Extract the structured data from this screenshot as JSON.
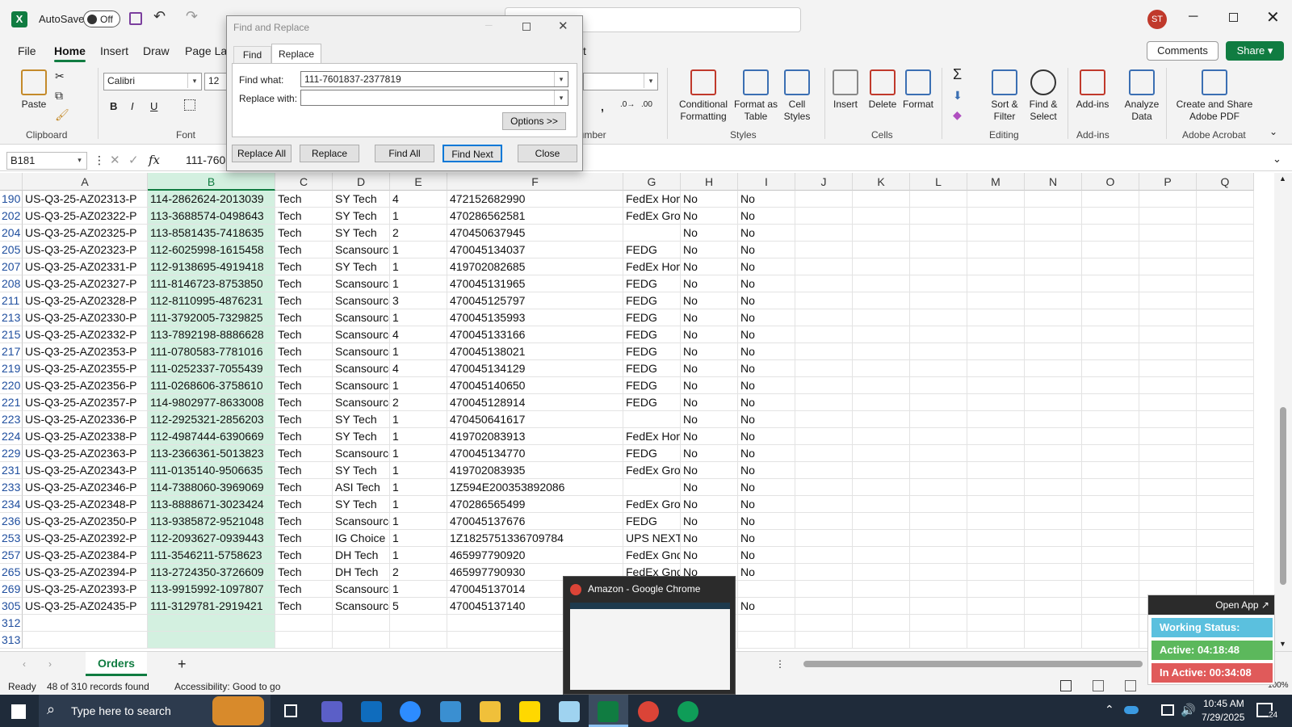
{
  "titlebar": {
    "autosave_label": "AutoSave",
    "autosave_state": "Off",
    "avatar_initials": "ST"
  },
  "menu": {
    "items": [
      "File",
      "Home",
      "Insert",
      "Draw",
      "Page Layout",
      "t"
    ],
    "comments": "Comments",
    "share": "Share"
  },
  "ribbon": {
    "paste": "Paste",
    "clipboard": "Clipboard",
    "font_name": "Calibri",
    "font_size": "12",
    "font_group": "Font",
    "number_group": "Number",
    "conditional": "Conditional Formatting",
    "format_table": "Format as Table",
    "cell_styles": "Cell Styles",
    "styles_group": "Styles",
    "insert": "Insert",
    "delete": "Delete",
    "format": "Format",
    "cells_group": "Cells",
    "sort_filter": "Sort & Filter",
    "find_select": "Find & Select",
    "editing_group": "Editing",
    "addins": "Add-ins",
    "addins_group": "Add-ins",
    "analyze": "Analyze Data",
    "create_pdf": "Create and Share Adobe PDF",
    "acrobat_group": "Adobe Acrobat"
  },
  "formula_bar": {
    "name_box": "B181",
    "fx": "fx",
    "content": "111-7601837-2377819"
  },
  "dialog": {
    "title": "Find and Replace",
    "tab_find": "Find",
    "tab_replace": "Replace",
    "find_label": "Find what:",
    "find_value": "111-7601837-2377819",
    "replace_label": "Replace with:",
    "replace_value": "",
    "options": "Options >>",
    "replace_all": "Replace All",
    "replace": "Replace",
    "find_all": "Find All",
    "find_next": "Find Next",
    "close": "Close"
  },
  "columns": [
    "A",
    "B",
    "C",
    "D",
    "E",
    "F",
    "G",
    "H",
    "I",
    "J",
    "K",
    "L",
    "M",
    "N",
    "O",
    "P",
    "Q"
  ],
  "rows": [
    [
      "190",
      "US-Q3-25-AZ02313-P",
      "114-2862624-2013039",
      "Tech",
      "SY Tech",
      "4",
      "472152682990",
      "FedEx Hom",
      "No",
      "No"
    ],
    [
      "202",
      "US-Q3-25-AZ02322-P",
      "113-3688574-0498643",
      "Tech",
      "SY Tech",
      "1",
      "470286562581",
      "FedEx Grou",
      "No",
      "No"
    ],
    [
      "204",
      "US-Q3-25-AZ02325-P",
      "113-8581435-7418635",
      "Tech",
      "SY Tech",
      "2",
      "470450637945",
      "",
      "No",
      "No"
    ],
    [
      "205",
      "US-Q3-25-AZ02323-P",
      "112-6025998-1615458",
      "Tech",
      "Scansource",
      "1",
      "470045134037",
      "FEDG",
      "No",
      "No"
    ],
    [
      "207",
      "US-Q3-25-AZ02331-P",
      "112-9138695-4919418",
      "Tech",
      "SY Tech",
      "1",
      "419702082685",
      "FedEx Hom",
      "No",
      "No"
    ],
    [
      "208",
      "US-Q3-25-AZ02327-P",
      "111-8146723-8753850",
      "Tech",
      "Scansource",
      "1",
      "470045131965",
      "FEDG",
      "No",
      "No"
    ],
    [
      "211",
      "US-Q3-25-AZ02328-P",
      "112-8110995-4876231",
      "Tech",
      "Scansource",
      "3",
      "470045125797",
      "FEDG",
      "No",
      "No"
    ],
    [
      "213",
      "US-Q3-25-AZ02330-P",
      "111-3792005-7329825",
      "Tech",
      "Scansource",
      "1",
      "470045135993",
      "FEDG",
      "No",
      "No"
    ],
    [
      "215",
      "US-Q3-25-AZ02332-P",
      "113-7892198-8886628",
      "Tech",
      "Scansource",
      "4",
      "470045133166",
      "FEDG",
      "No",
      "No"
    ],
    [
      "217",
      "US-Q3-25-AZ02353-P",
      "111-0780583-7781016",
      "Tech",
      "Scansource",
      "1",
      "470045138021",
      "FEDG",
      "No",
      "No"
    ],
    [
      "219",
      "US-Q3-25-AZ02355-P",
      "111-0252337-7055439",
      "Tech",
      "Scansource",
      "4",
      "470045134129",
      "FEDG",
      "No",
      "No"
    ],
    [
      "220",
      "US-Q3-25-AZ02356-P",
      "111-0268606-3758610",
      "Tech",
      "Scansource",
      "1",
      "470045140650",
      "FEDG",
      "No",
      "No"
    ],
    [
      "221",
      "US-Q3-25-AZ02357-P",
      "114-9802977-8633008",
      "Tech",
      "Scansource",
      "2",
      "470045128914",
      "FEDG",
      "No",
      "No"
    ],
    [
      "223",
      "US-Q3-25-AZ02336-P",
      "112-2925321-2856203",
      "Tech",
      "SY Tech",
      "1",
      "470450641617",
      "",
      "No",
      "No"
    ],
    [
      "224",
      "US-Q3-25-AZ02338-P",
      "112-4987444-6390669",
      "Tech",
      "SY Tech",
      "1",
      "419702083913",
      "FedEx Hom",
      "No",
      "No"
    ],
    [
      "229",
      "US-Q3-25-AZ02363-P",
      "113-2366361-5013823",
      "Tech",
      "Scansource",
      "1",
      "470045134770",
      "FEDG",
      "No",
      "No"
    ],
    [
      "231",
      "US-Q3-25-AZ02343-P",
      "111-0135140-9506635",
      "Tech",
      "SY Tech",
      "1",
      "419702083935",
      "FedEx Grou",
      "No",
      "No"
    ],
    [
      "233",
      "US-Q3-25-AZ02346-P",
      "114-7388060-3969069",
      "Tech",
      "ASI Tech",
      "1",
      "1Z594E200353892086",
      "",
      "No",
      "No"
    ],
    [
      "234",
      "US-Q3-25-AZ02348-P",
      "113-8888671-3023424",
      "Tech",
      "SY Tech",
      "1",
      "470286565499",
      "FedEx Grou",
      "No",
      "No"
    ],
    [
      "236",
      "US-Q3-25-AZ02350-P",
      "113-9385872-9521048",
      "Tech",
      "Scansource",
      "1",
      "470045137676",
      "FEDG",
      "No",
      "No"
    ],
    [
      "253",
      "US-Q3-25-AZ02392-P",
      "112-2093627-0939443",
      "Tech",
      "IG Choice",
      "1",
      "1Z1825751336709784",
      "UPS NEXT I",
      "No",
      "No"
    ],
    [
      "257",
      "US-Q3-25-AZ02384-P",
      "111-3546211-5758623",
      "Tech",
      "DH Tech",
      "1",
      "465997790920",
      "FedEx Gnd",
      "No",
      "No"
    ],
    [
      "265",
      "US-Q3-25-AZ02394-P",
      "113-2724350-3726609",
      "Tech",
      "DH Tech",
      "2",
      "465997790930",
      "FedEx Gnd",
      "No",
      "No"
    ],
    [
      "269",
      "US-Q3-25-AZ02393-P",
      "113-9915992-1097807",
      "Tech",
      "Scansource",
      "1",
      "470045137014",
      "",
      "",
      ""
    ],
    [
      "305",
      "US-Q3-25-AZ02435-P",
      "111-3129781-2919421",
      "Tech",
      "Scansource",
      "5",
      "470045137140",
      "",
      "",
      "No"
    ],
    [
      "312",
      "",
      "",
      "",
      "",
      "",
      "",
      "",
      "",
      ""
    ],
    [
      "313",
      "",
      "",
      "",
      "",
      "",
      "",
      "",
      "",
      ""
    ]
  ],
  "sheet": {
    "tab": "Orders",
    "add": "+"
  },
  "status": {
    "ready": "Ready",
    "records": "48 of 310 records found",
    "accessibility": "Accessibility: Good to go",
    "zoom": "100%"
  },
  "preview": {
    "title": "Amazon - Google Chrome"
  },
  "widget": {
    "open_app": "Open App ↗",
    "status": "Working Status: Active",
    "active": "Active: 04:18:48",
    "inactive": "In Active: 00:34:08",
    "colors": {
      "status": "#5bc0de",
      "active": "#5cb85c",
      "inactive": "#e05a5a"
    }
  },
  "taskbar": {
    "search": "Type here to search",
    "time": "10:45 AM",
    "date": "7/29/2025",
    "notif": "24"
  }
}
